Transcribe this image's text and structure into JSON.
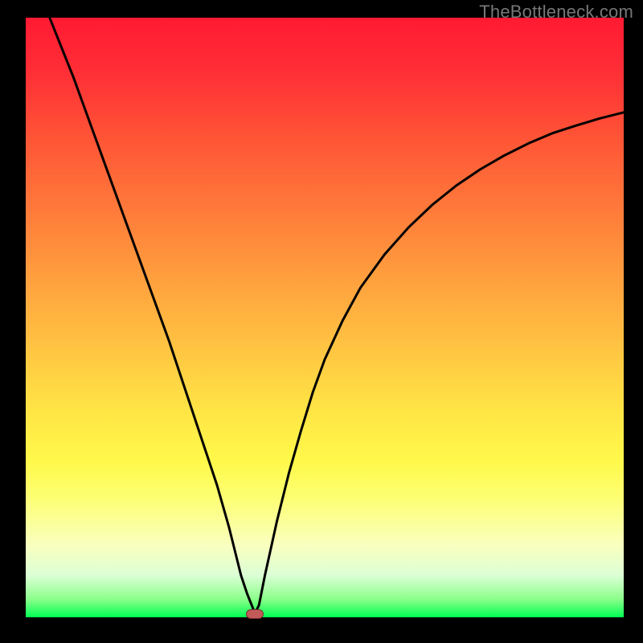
{
  "watermark": "TheBottleneck.com",
  "chart_data": {
    "type": "line",
    "title": "",
    "xlabel": "",
    "ylabel": "",
    "xlim": [
      0,
      100
    ],
    "ylim": [
      0,
      100
    ],
    "series": [
      {
        "name": "curve",
        "x": [
          4,
          6,
          8,
          10,
          12,
          14,
          16,
          18,
          20,
          22,
          24,
          26,
          28,
          30,
          32,
          34,
          35,
          36,
          37,
          38,
          38.3,
          39,
          40,
          42,
          44,
          46,
          48,
          50,
          53,
          56,
          60,
          64,
          68,
          72,
          76,
          80,
          84,
          88,
          92,
          96,
          100
        ],
        "y": [
          100,
          95,
          90,
          84.5,
          79,
          73.5,
          68,
          62.5,
          57,
          51.5,
          46,
          40,
          34,
          28,
          22,
          15,
          11,
          7,
          4,
          1.5,
          0.6,
          2,
          7,
          16,
          24,
          31,
          37.5,
          43,
          49.5,
          55,
          60.5,
          65,
          68.8,
          72,
          74.7,
          77,
          79,
          80.7,
          82,
          83.2,
          84.2
        ]
      }
    ],
    "marker": {
      "x": 38.3,
      "y": 0.6,
      "color": "#c35a5a"
    },
    "background_gradient": [
      "#ff1a33",
      "#ffe645",
      "#00ff52"
    ]
  }
}
